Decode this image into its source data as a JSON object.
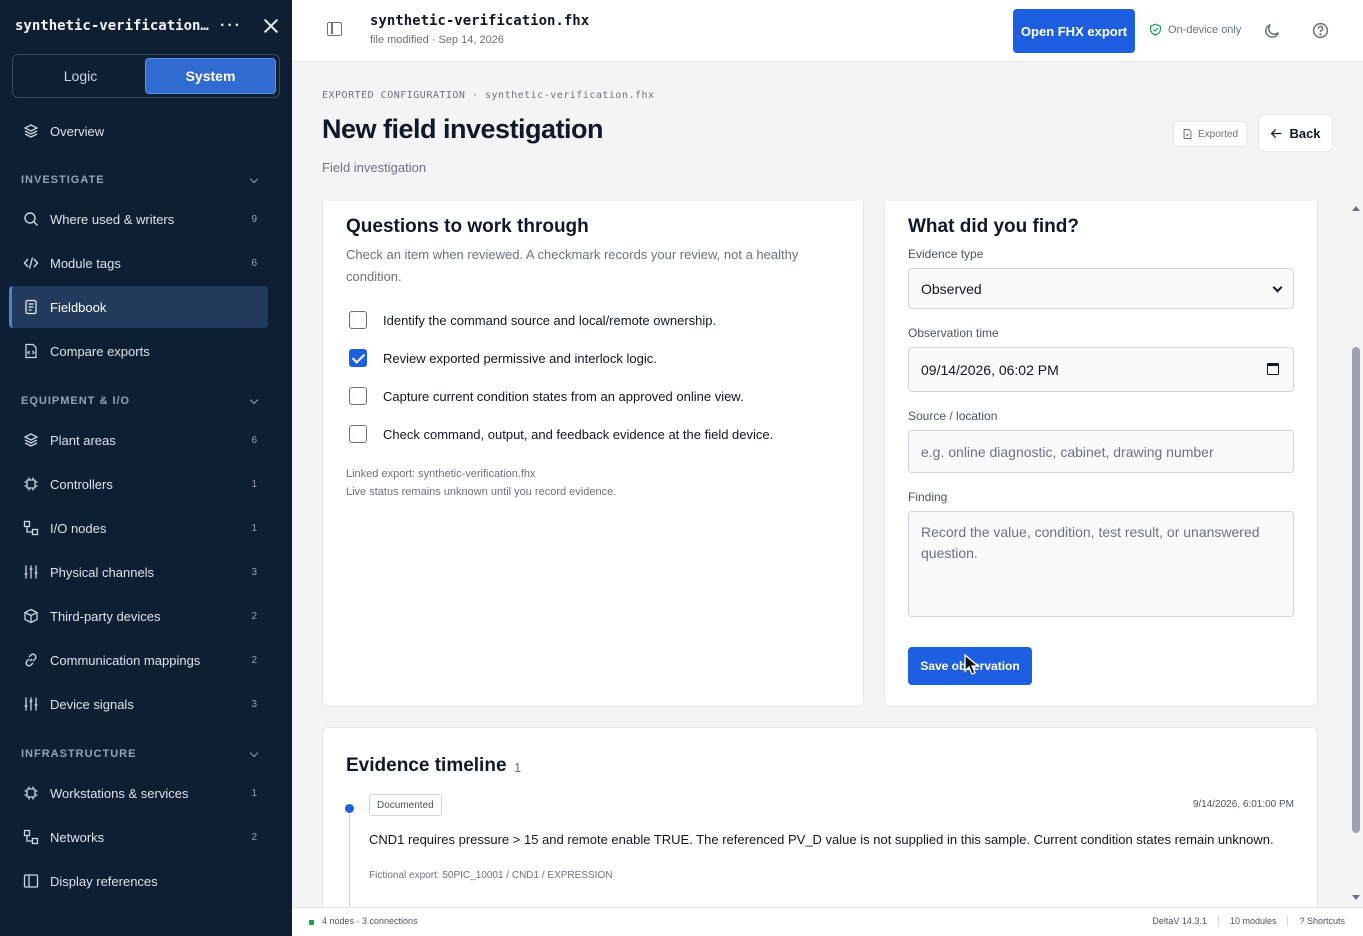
{
  "sidebar": {
    "title": "synthetic-verification…",
    "more": "···",
    "tabs": [
      {
        "label": "Logic"
      },
      {
        "label": "System"
      }
    ],
    "overview": {
      "label": "Overview"
    },
    "sections": {
      "investigate": "INVESTIGATE",
      "equipment": "EQUIPMENT & I/O",
      "infrastructure": "INFRASTRUCTURE"
    },
    "items": {
      "where_used": {
        "label": "Where used & writers",
        "count": "9"
      },
      "module_tags": {
        "label": "Module tags",
        "count": "6"
      },
      "fieldbook": {
        "label": "Fieldbook"
      },
      "compare": {
        "label": "Compare exports"
      },
      "plant_areas": {
        "label": "Plant areas",
        "count": "6"
      },
      "controllers": {
        "label": "Controllers",
        "count": "1"
      },
      "io_nodes": {
        "label": "I/O nodes",
        "count": "1"
      },
      "physical_channels": {
        "label": "Physical channels",
        "count": "3"
      },
      "third_party": {
        "label": "Third-party devices",
        "count": "2"
      },
      "comm_mappings": {
        "label": "Communication mappings",
        "count": "2"
      },
      "device_signals": {
        "label": "Device signals",
        "count": "3"
      },
      "workstations": {
        "label": "Workstations & services",
        "count": "1"
      },
      "networks": {
        "label": "Networks",
        "count": "2"
      },
      "display_refs": {
        "label": "Display references"
      }
    }
  },
  "topbar": {
    "filename": "synthetic-verification.fhx",
    "modified": "file modified · Sep 14, 2026",
    "open_button": "Open FHX export",
    "device_only": "On-device only"
  },
  "page": {
    "breadcrumb": "EXPORTED CONFIGURATION · synthetic-verification.fhx",
    "title": "New field investigation",
    "subtitle": "Field investigation",
    "exported_badge": "Exported",
    "back": "Back"
  },
  "questions": {
    "title": "Questions to work through",
    "intro": "Check an item when reviewed. A checkmark records your review, not a healthy condition.",
    "items": [
      {
        "label": "Identify the command source and local/remote ownership.",
        "checked": false
      },
      {
        "label": "Review exported permissive and interlock logic.",
        "checked": true
      },
      {
        "label": "Capture current condition states from an approved online view.",
        "checked": false
      },
      {
        "label": "Check command, output, and feedback evidence at the field device.",
        "checked": false
      }
    ],
    "linked_export": "Linked export: synthetic-verification.fhx",
    "live_status": "Live status remains unknown until you record evidence."
  },
  "finding": {
    "title": "What did you find?",
    "evidence_type_label": "Evidence type",
    "evidence_type_value": "Observed",
    "obs_time_label": "Observation time",
    "obs_time_value": "09/14/2026, 06:02 PM",
    "source_label": "Source / location",
    "source_placeholder": "e.g. online diagnostic, cabinet, drawing number",
    "finding_label": "Finding",
    "finding_placeholder": "Record the value, condition, test result, or unanswered question.",
    "save": "Save observation"
  },
  "timeline": {
    "title": "Evidence timeline",
    "count": "1",
    "entries": [
      {
        "badge": "Documented",
        "time": "9/14/2026, 6:01:00 PM",
        "text": "CND1 requires pressure > 15 and remote enable TRUE. The referenced PV_D value is not supplied in this sample. Current condition states remain unknown.",
        "source": "Fictional export: 50PIC_10001 / CND1 / EXPRESSION"
      }
    ]
  },
  "status": {
    "nodes": "4 nodes · 3 connections",
    "version": "DeltaV 14.3.1",
    "modules": "10 modules",
    "shortcuts": "? Shortcuts"
  }
}
